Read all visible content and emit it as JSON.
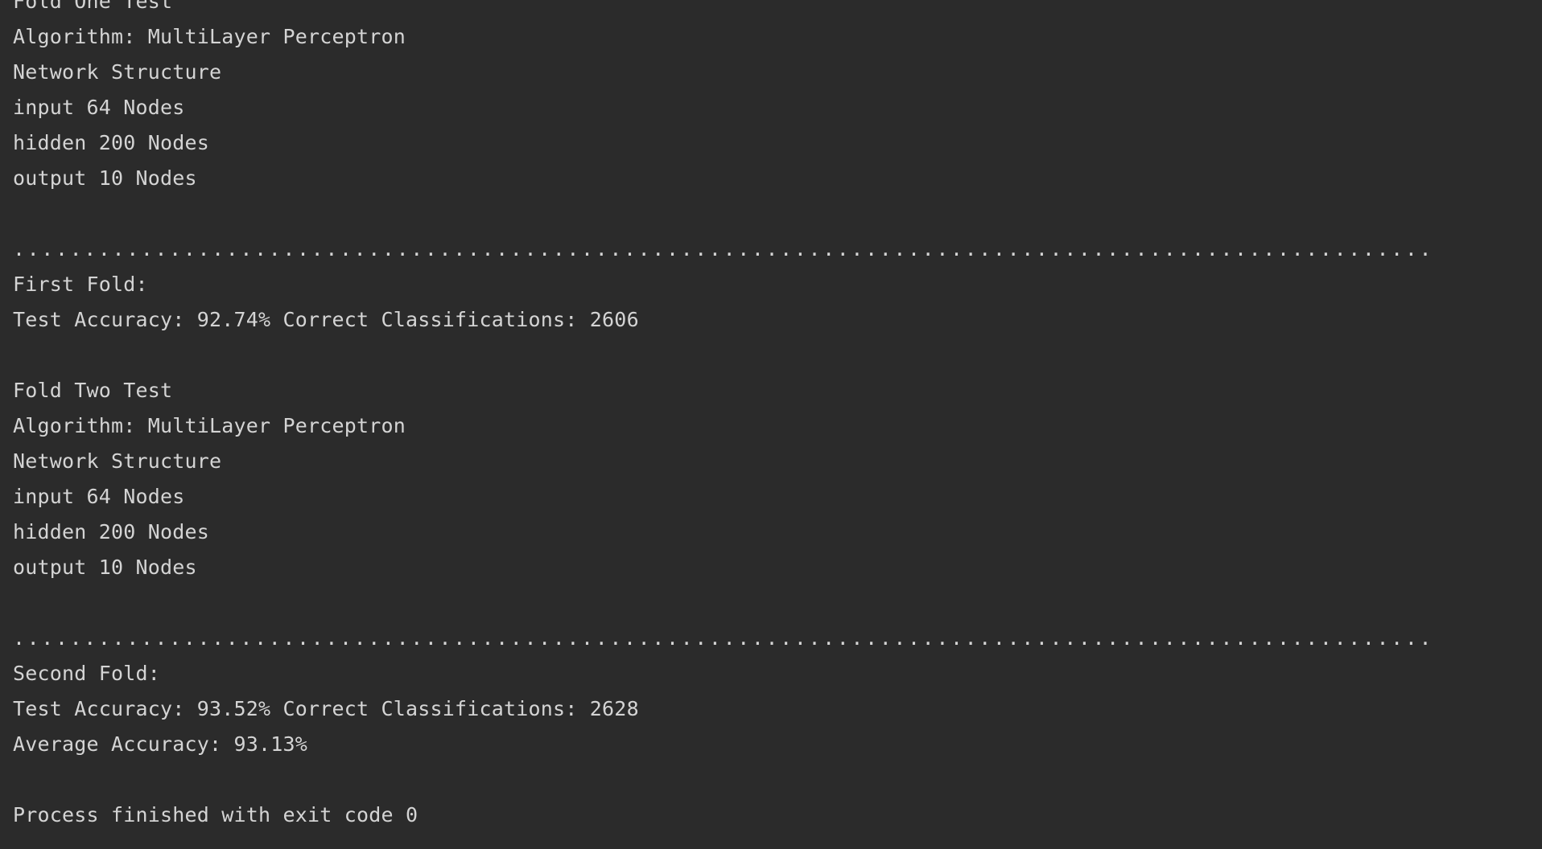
{
  "console": {
    "lines": [
      {
        "kind": "text",
        "text": "Fold One Test"
      },
      {
        "kind": "text",
        "text": "Algorithm: MultiLayer Perceptron"
      },
      {
        "kind": "text",
        "text": "Network Structure"
      },
      {
        "kind": "text",
        "text": "input 64 Nodes"
      },
      {
        "kind": "text",
        "text": "hidden 200 Nodes"
      },
      {
        "kind": "text",
        "text": "output 10 Nodes"
      },
      {
        "kind": "blank",
        "text": ""
      },
      {
        "kind": "separator",
        "text": "...................................................................................................."
      },
      {
        "kind": "text",
        "text": "First Fold:"
      },
      {
        "kind": "text",
        "text": "Test Accuracy: 92.74% Correct Classifications: 2606"
      },
      {
        "kind": "blank",
        "text": ""
      },
      {
        "kind": "text",
        "text": "Fold Two Test"
      },
      {
        "kind": "text",
        "text": "Algorithm: MultiLayer Perceptron"
      },
      {
        "kind": "text",
        "text": "Network Structure"
      },
      {
        "kind": "text",
        "text": "input 64 Nodes"
      },
      {
        "kind": "text",
        "text": "hidden 200 Nodes"
      },
      {
        "kind": "text",
        "text": "output 10 Nodes"
      },
      {
        "kind": "blank",
        "text": ""
      },
      {
        "kind": "separator",
        "text": "...................................................................................................."
      },
      {
        "kind": "text",
        "text": "Second Fold:"
      },
      {
        "kind": "text",
        "text": "Test Accuracy: 93.52% Correct Classifications: 2628"
      },
      {
        "kind": "text",
        "text": "Average Accuracy: 93.13%"
      },
      {
        "kind": "blank",
        "text": ""
      },
      {
        "kind": "text",
        "text": "Process finished with exit code 0"
      }
    ]
  },
  "colors": {
    "background": "#2b2b2b",
    "text": "#d4d4d4"
  }
}
